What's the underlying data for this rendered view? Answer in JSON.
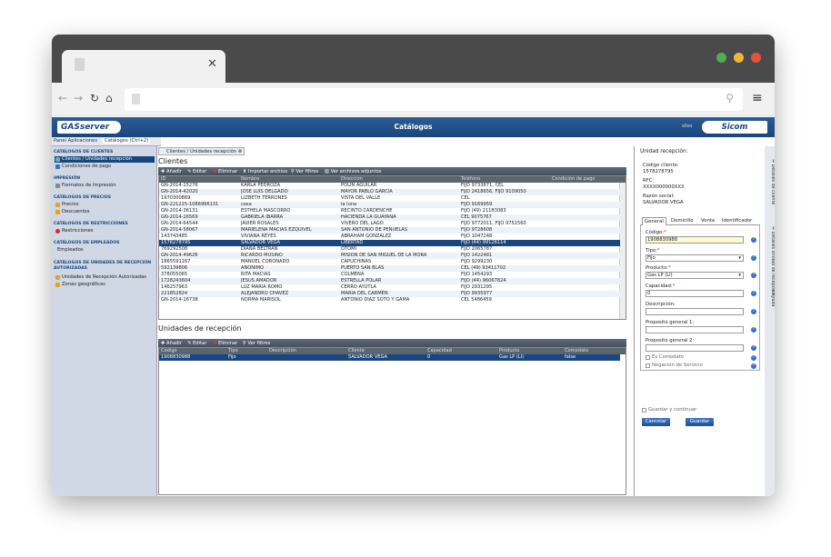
{
  "app": {
    "title": "Catálogos",
    "user_menu": "sfoo",
    "logo_left": "GASserver",
    "logo_right": "Sicom"
  },
  "top_tabs": [
    "Panel Aplicaciones",
    "Catálogos (Ctrl+2)"
  ],
  "sidebar": {
    "sections": [
      {
        "header": "CATÁLOGOS DE CLIENTES",
        "items": [
          "Clientes / Unidades recepción",
          "Condiciones de pago"
        ]
      },
      {
        "header": "IMPRESIÓN",
        "items": [
          "Formatos de Impresión"
        ]
      },
      {
        "header": "CATÁLOGOS DE PRECIOS",
        "items": [
          "Precios",
          "Descuentos"
        ]
      },
      {
        "header": "CATÁLOGOS DE RESTRICCIONES",
        "items": [
          "Restricciones"
        ]
      },
      {
        "header": "CATÁLOGOS DE EMPLEADOS",
        "items": [
          "Empleados"
        ]
      },
      {
        "header": "CATÁLOGOS DE UNIDADES DE RECEPCIÓN AUTORIZADAS",
        "items": [
          "Unidades de Recepción Autorizadas",
          "Zonas geográficas"
        ]
      }
    ]
  },
  "main": {
    "tab": "Clientes / Unidades recepción",
    "clients_title": "Clientes",
    "clients_toolbar": [
      "Añadir",
      "Editar",
      "Eliminar",
      "Importar archivo",
      "Ver filtros",
      "Ver archivos adjuntos"
    ],
    "clients_columns": [
      "ID",
      "Nombre",
      "Dirección",
      "Teléfono",
      "Condición de pago"
    ],
    "clients_rows": [
      [
        "GN-2014-15276",
        "KARLA PEDROZA",
        "POLIN AGUILAR",
        "FIJO 9733871, CEL"
      ],
      [
        "GN-2014-42020",
        "JOSE LUIS DELGADO",
        "MAYOR PABLO GARCIA",
        "FIJO 2418656, FIJO 9109050"
      ],
      [
        "1970300869",
        "LIZBETH TERRONES",
        "VISTA DEL VALLE",
        "CEL"
      ],
      [
        "GN-221215-1086966131",
        "casa",
        "la luna",
        "FIJO 9169959"
      ],
      [
        "GN-2014-36131",
        "ESTHELA MASCORRO",
        "RECINTO CARDENCHE",
        "FIJO (49) 21183083"
      ],
      [
        "GN-2014-26569",
        "GABRIELA IBARRA",
        "HACIENDA LA GUAYANA",
        "CEL 9075767"
      ],
      [
        "GN-2014-64544",
        "JAVIER ROSALES",
        "VIVERO DEL LAGO",
        "FIJO 9772011, FIJO 9752560"
      ],
      [
        "GN-2014-58067",
        "MARIELENA MACIAS EZQUIVEL",
        "SAN ANTONIO DE PEÑUELAS",
        "FIJO 9728608"
      ],
      [
        "143743485",
        "VIVIANA REYES",
        "ABRAHAM GONZALEZ",
        "FIJO 1047248"
      ],
      [
        "1578278795",
        "SALVADOR VEGA",
        "LIBERTAD",
        "FIJO (44) 99126114"
      ],
      [
        "769292508",
        "DIANA BELTRAN",
        "OTOMI",
        "FIJO 2065787"
      ],
      [
        "GN-2014-49626",
        "RICARDO MUSIÑO",
        "MISION DE SAN MIGUEL DE LA MORA",
        "FIJO 1422481"
      ],
      [
        "1865591167",
        "MANUEL CORONADO",
        "CAPUCHINAS",
        "FIJO 9299230"
      ],
      [
        "592139806",
        "ANONIMO",
        "PUERTO SAN BLAS",
        "CEL (49) 93411702"
      ],
      [
        "378055065",
        "RITA MACIAS",
        "COLMENA",
        "FIJO 1454293"
      ],
      [
        "1728243604",
        "JESUS AMADOR",
        "ESTRELLA POLAR",
        "FIJO (44) 96067824"
      ],
      [
        "146257963",
        "LUZ MARIA ROMO",
        "CERRO AYUTLA",
        "FIJO 2931295"
      ],
      [
        "221852824",
        "ALEJANDRO CHAVEZ",
        "MARIA DEL CARMEN",
        "FIJO 9935977"
      ],
      [
        "GN-2014-16738",
        "NORMA MARISOL",
        "ANTONIO DIAZ SOTO Y GAMA",
        "CEL 5486459"
      ]
    ],
    "units_title": "Unidades de recepción",
    "units_toolbar": [
      "Añadir",
      "Editar",
      "Eliminar",
      "Ver filtros"
    ],
    "units_columns": [
      "Código",
      "Tipo",
      "Descripción",
      "Cliente",
      "Capacidad",
      "Producto",
      "Comodato"
    ],
    "units_rows": [
      [
        "1908830988",
        "Fijo",
        "",
        "SALVADOR VEGA",
        "0",
        "Gas LP (LI)",
        "false"
      ]
    ]
  },
  "detail": {
    "title": "Unidad recepción:",
    "code_label": "Código cliente:",
    "code_value": "1578278795",
    "rfc_label": "RFC:",
    "rfc_value": "XXXX000000XXX",
    "rs_label": "Razón social:",
    "rs_value": "SALVADOR VEGA",
    "tabs": [
      "General",
      "Domicilio",
      "Venta",
      "Identificador"
    ],
    "fields": {
      "codigo_label": "Código:",
      "codigo_value": "1908830988",
      "tipo_label": "Tipo:",
      "tipo_value": "Fijo",
      "producto_label": "Producto:",
      "producto_value": "Gas LP (LI)",
      "capacidad_label": "Capacidad:",
      "capacidad_value": "0",
      "descripcion_label": "Descripción:",
      "pg1_label": "Proposito general 1:",
      "pg2_label": "Proposito general 2:",
      "comodato_label": "Es Comodato",
      "negacion_label": "Negacion de Servicio"
    },
    "guardar_continuar": "Guardar y continuar",
    "cancel": "Cancelar",
    "save": "Guardar"
  },
  "side_tabs": [
    "Detalles de cliente",
    "Detalles unidad de recepción",
    "Ayuda"
  ]
}
